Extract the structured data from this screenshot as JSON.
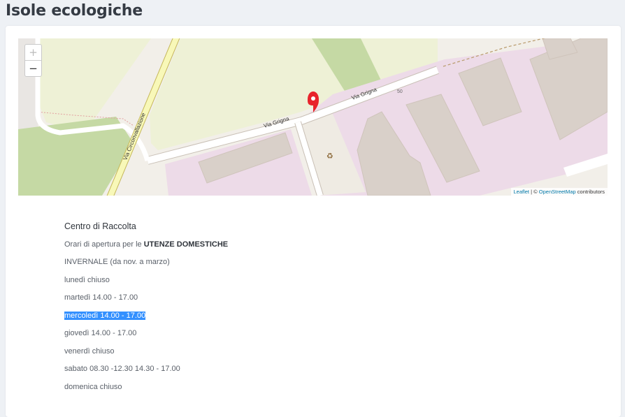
{
  "page": {
    "title": "Isole ecologiche"
  },
  "map": {
    "zoom_in_label": "+",
    "zoom_out_label": "−",
    "street_labels": {
      "via_grigna_1": "Via Grigna",
      "via_grigna_2": "Via Grigna",
      "circonvallazione": "Via Circonvallazione",
      "number": "50"
    },
    "recycle_symbol": "♻",
    "attribution": {
      "leaflet": "Leaflet",
      "separator": " | © ",
      "osm": "OpenStreetMap",
      "suffix": " contributors"
    }
  },
  "info": {
    "title": "Centro di Raccolta",
    "hours_intro_prefix": "Orari di apertura per le ",
    "hours_intro_bold": "UTENZE DOMESTICHE",
    "season": "INVERNALE (da nov. a marzo)",
    "days": [
      "lunedì chiuso",
      "martedì 14.00 - 17.00",
      "mercoledì 14.00 - 17.00",
      "giovedì 14.00 - 17.00",
      "venerdì chiuso",
      "sabato 08.30 -12.30 14.30 - 17.00",
      "domenica chiuso"
    ],
    "selected_day_index": 2
  },
  "colors": {
    "selection": "#3390ff",
    "marker": "#e8232b",
    "industrial": "#eddbe8",
    "building": "#d9d0c9",
    "grass": "#eef1d6",
    "wood": "#c5d9a4",
    "primary_road": "#f8f8b8"
  }
}
